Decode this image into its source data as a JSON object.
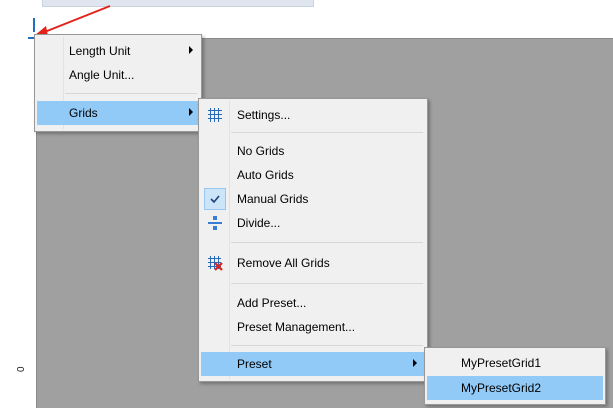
{
  "menu1": {
    "items": [
      {
        "label": "Length Unit",
        "has_submenu": true
      },
      {
        "label": "Angle Unit...",
        "has_submenu": false
      },
      {
        "label": "Grids",
        "has_submenu": true,
        "highlighted": true
      }
    ]
  },
  "menu2": {
    "items": [
      {
        "label": "Settings...",
        "icon": "grid-settings-icon"
      },
      {
        "label": "No Grids"
      },
      {
        "label": "Auto Grids"
      },
      {
        "label": "Manual Grids",
        "checked": true
      },
      {
        "label": "Divide...",
        "icon": "divide-icon"
      },
      {
        "label": "Remove All Grids",
        "icon": "remove-grids-icon"
      },
      {
        "label": "Add Preset..."
      },
      {
        "label": "Preset Management..."
      },
      {
        "label": "Preset",
        "has_submenu": true,
        "highlighted": true
      }
    ]
  },
  "menu3": {
    "items": [
      {
        "label": "MyPresetGrid1"
      },
      {
        "label": "MyPresetGrid2",
        "highlighted": true
      }
    ]
  },
  "ruler": {
    "left_label": "0"
  },
  "colors": {
    "highlight": "#91c9f7",
    "menu_bg": "#f0f0f0",
    "canvas": "#a0a0a0",
    "arrow": "#e3231b",
    "marker": "#1f6fc5"
  }
}
